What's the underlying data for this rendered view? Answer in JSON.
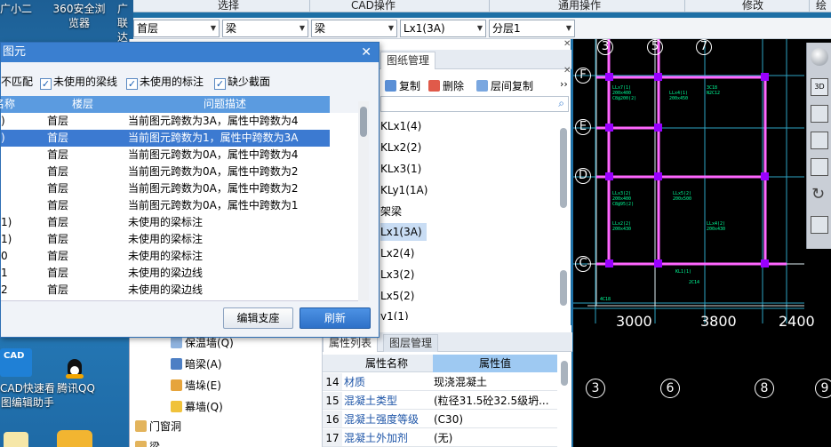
{
  "desktop": {
    "top_labels": [
      "广小二",
      "360安全浏览器",
      "广联达建"
    ],
    "icons": [
      {
        "label_line1": "CAD快速看",
        "label_line2": "图编辑助手"
      },
      {
        "label_line1": "腾讯QQ",
        "label_line2": ""
      }
    ]
  },
  "menubar": {
    "items": [
      "选择",
      "CAD操作",
      "通用操作",
      "修改",
      "绘"
    ]
  },
  "combos": {
    "floor": "首层",
    "category": "梁",
    "type": "梁",
    "element": "Lx1(3A)",
    "layer": "分层1"
  },
  "dialog": {
    "title": "图元",
    "close": "✕",
    "checkboxes": [
      {
        "label": "不匹配",
        "checked": false
      },
      {
        "label": "未使用的梁线",
        "checked": true
      },
      {
        "label": "未使用的标注",
        "checked": true
      },
      {
        "label": "缺少截面",
        "checked": true
      }
    ],
    "columns": [
      "名称",
      "楼层",
      "问题描述"
    ],
    "rows": [
      {
        "name": ")",
        "floor": "首层",
        "desc": "当前图元跨数为3A，属性中跨数为4",
        "selected": false
      },
      {
        "name": ")",
        "floor": "首层",
        "desc": "当前图元跨数为1，属性中跨数为3A",
        "selected": true
      },
      {
        "name": "",
        "floor": "首层",
        "desc": "当前图元跨数为0A，属性中跨数为4",
        "selected": false
      },
      {
        "name": "",
        "floor": "首层",
        "desc": "当前图元跨数为0A，属性中跨数为2",
        "selected": false
      },
      {
        "name": "",
        "floor": "首层",
        "desc": "当前图元跨数为0A，属性中跨数为2",
        "selected": false
      },
      {
        "name": "",
        "floor": "首层",
        "desc": "当前图元跨数为0A，属性中跨数为1",
        "selected": false
      },
      {
        "name": "1)",
        "floor": "首层",
        "desc": "未使用的梁标注",
        "selected": false
      },
      {
        "name": "1)",
        "floor": "首层",
        "desc": "未使用的梁标注",
        "selected": false
      },
      {
        "name": "0",
        "floor": "首层",
        "desc": "未使用的梁标注",
        "selected": false
      },
      {
        "name": "1",
        "floor": "首层",
        "desc": "未使用的梁边线",
        "selected": false
      },
      {
        "name": "2",
        "floor": "首层",
        "desc": "未使用的梁边线",
        "selected": false
      }
    ],
    "edit_button": "编辑支座",
    "refresh_button": "刷新"
  },
  "drawing_panel": {
    "tab": "图纸管理",
    "toolbar": [
      "复制",
      "删除",
      "层间复制"
    ],
    "more": "››",
    "items": [
      "KLx1(4)",
      "KLx2(2)",
      "KLx3(1)",
      "KLy1(1A)",
      "架梁",
      "Lx1(3A)",
      "Lx2(4)",
      "Lx3(2)",
      "Lx5(2)",
      "y1(1)"
    ],
    "selected_index": 5
  },
  "tree": {
    "items": [
      "保温墙(Q)",
      "暗梁(A)",
      "墙垛(E)",
      "幕墙(Q)",
      "门窗洞",
      "梁"
    ]
  },
  "props": {
    "tabs": [
      "属性列表",
      "图层管理"
    ],
    "columns": [
      "属性名称",
      "属性值"
    ],
    "rows": [
      {
        "num": "14",
        "name": "材质",
        "value": "现浇混凝土"
      },
      {
        "num": "15",
        "name": "混凝土类型",
        "value": "(粒径31.5砼32.5级坍..."
      },
      {
        "num": "16",
        "name": "混凝土强度等级",
        "value": "(C30)"
      },
      {
        "num": "17",
        "name": "混凝土外加剂",
        "value": "(无)"
      }
    ]
  },
  "cad": {
    "axis_top": [
      "3",
      "5",
      "7"
    ],
    "axis_left": [
      "F",
      "E",
      "D",
      "C"
    ],
    "dims": [
      "3000",
      "3800",
      "2400"
    ],
    "axis_bottom": [
      "3",
      "6",
      "8",
      "9"
    ],
    "colors": {
      "bg": "#000000",
      "grid": "#2ea3c4",
      "beam": "#ff66ff",
      "column": "#9900ff",
      "text": "#00ff99",
      "line": "#ffffff"
    }
  }
}
